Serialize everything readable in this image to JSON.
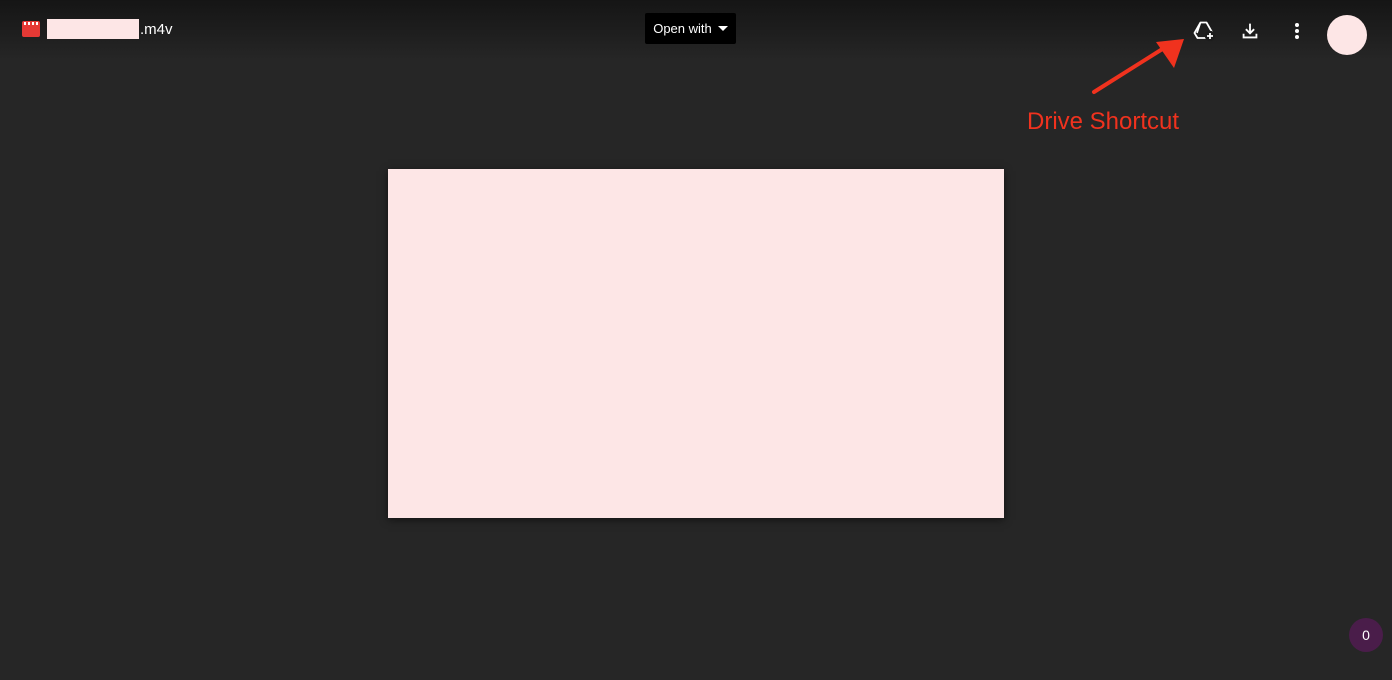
{
  "file": {
    "extension": ".m4v",
    "type_icon": "video-file-icon"
  },
  "toolbar": {
    "open_with_label": "Open with",
    "add_shortcut_icon": "add-to-drive-icon",
    "download_icon": "download-icon",
    "more_icon": "more-vert-icon"
  },
  "annotation": {
    "label": "Drive Shortcut",
    "color": "#f0321e"
  },
  "notification": {
    "count": "0"
  },
  "colors": {
    "background": "#262626",
    "redaction": "#fde6e6",
    "file_icon": "#e53935",
    "badge": "#4a1d4a"
  }
}
